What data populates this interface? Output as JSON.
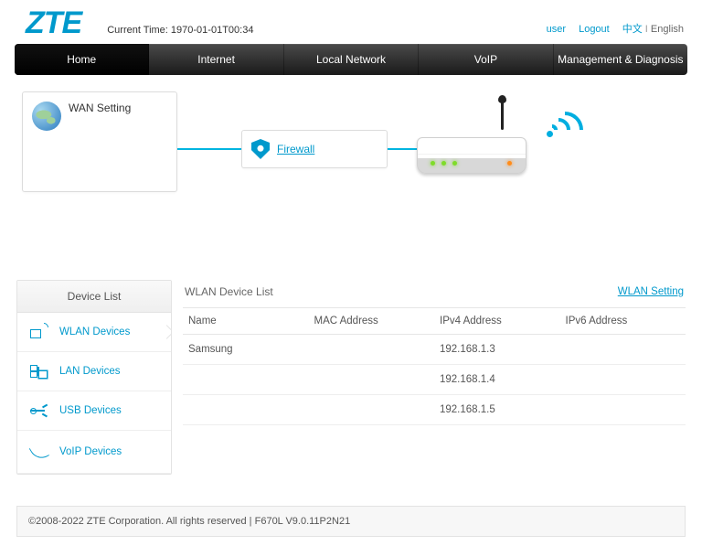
{
  "header": {
    "brand": "ZTE",
    "current_time_label": "Current Time:",
    "current_time_value": "1970-01-01T00:34",
    "user_label": "user",
    "logout_label": "Logout",
    "lang_cn": "中文",
    "lang_en": "English"
  },
  "nav": {
    "items": [
      "Home",
      "Internet",
      "Local Network",
      "VoIP",
      "Management & Diagnosis"
    ],
    "active_index": 0
  },
  "diagram": {
    "wan_label": "WAN Setting",
    "firewall_label": "Firewall"
  },
  "sidebar": {
    "title": "Device List",
    "items": [
      {
        "label": "WLAN Devices",
        "icon": "wlan"
      },
      {
        "label": "LAN Devices",
        "icon": "lan"
      },
      {
        "label": "USB Devices",
        "icon": "usb"
      },
      {
        "label": "VoIP Devices",
        "icon": "voip"
      }
    ],
    "active_index": 0
  },
  "devicelist": {
    "title": "WLAN Device List",
    "setting_link": "WLAN Setting",
    "columns": [
      "Name",
      "MAC Address",
      "IPv4 Address",
      "IPv6 Address"
    ],
    "rows": [
      {
        "name": "Samsung",
        "mac": "",
        "ipv4": "192.168.1.3",
        "ipv6": ""
      },
      {
        "name": "",
        "mac": "",
        "ipv4": "192.168.1.4",
        "ipv6": ""
      },
      {
        "name": "",
        "mac": "",
        "ipv4": "192.168.1.5",
        "ipv6": ""
      }
    ]
  },
  "footer": {
    "copyright": "©2008-2022 ZTE Corporation. All rights reserved",
    "sep": "  |  ",
    "version": "F670L V9.0.11P2N21"
  }
}
